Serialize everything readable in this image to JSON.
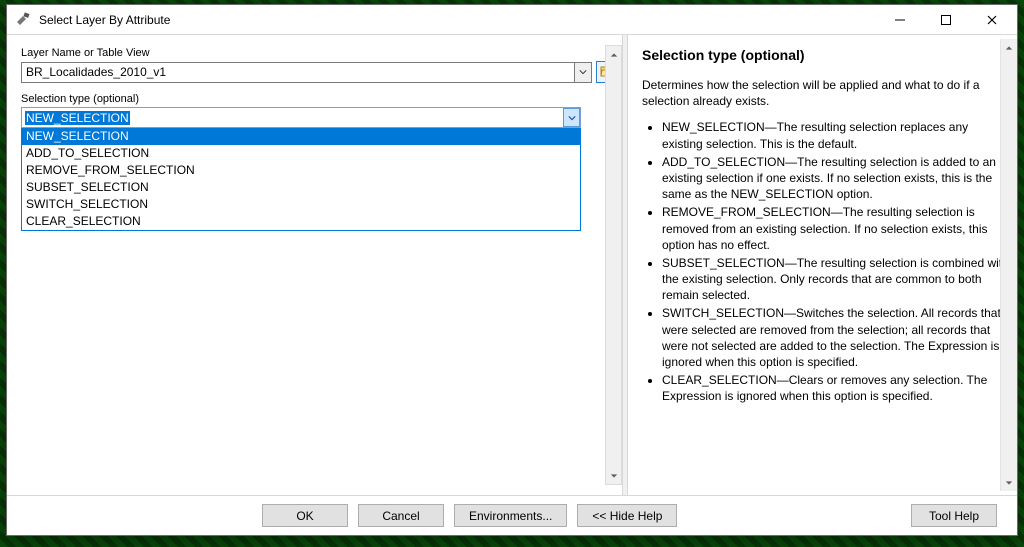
{
  "window": {
    "title": "Select Layer By Attribute"
  },
  "left": {
    "layer_label": "Layer Name or Table View",
    "layer_value": "BR_Localidades_2010_v1",
    "seltype_label": "Selection type (optional)",
    "seltype_value": "NEW_SELECTION",
    "seltype_options": [
      "NEW_SELECTION",
      "ADD_TO_SELECTION",
      "REMOVE_FROM_SELECTION",
      "SUBSET_SELECTION",
      "SWITCH_SELECTION",
      "CLEAR_SELECTION"
    ]
  },
  "help": {
    "heading": "Selection type (optional)",
    "intro": "Determines how the selection will be applied and what to do if a selection already exists.",
    "items": [
      "NEW_SELECTION—The resulting selection replaces any existing selection. This is the default.",
      "ADD_TO_SELECTION—The resulting selection is added to an existing selection if one exists. If no selection exists, this is the same as the NEW_SELECTION option.",
      "REMOVE_FROM_SELECTION—The resulting selection is removed from an existing selection. If no selection exists, this option has no effect.",
      "SUBSET_SELECTION—The resulting selection is combined with the existing selection. Only records that are common to both remain selected.",
      "SWITCH_SELECTION—Switches the selection. All records that were selected are removed from the selection; all records that were not selected are added to the selection. The Expression is ignored when this option is specified.",
      "CLEAR_SELECTION—Clears or removes any selection. The Expression is ignored when this option is specified."
    ]
  },
  "buttons": {
    "ok": "OK",
    "cancel": "Cancel",
    "env": "Environments...",
    "hidehelp": "<< Hide Help",
    "toolhelp": "Tool Help"
  }
}
